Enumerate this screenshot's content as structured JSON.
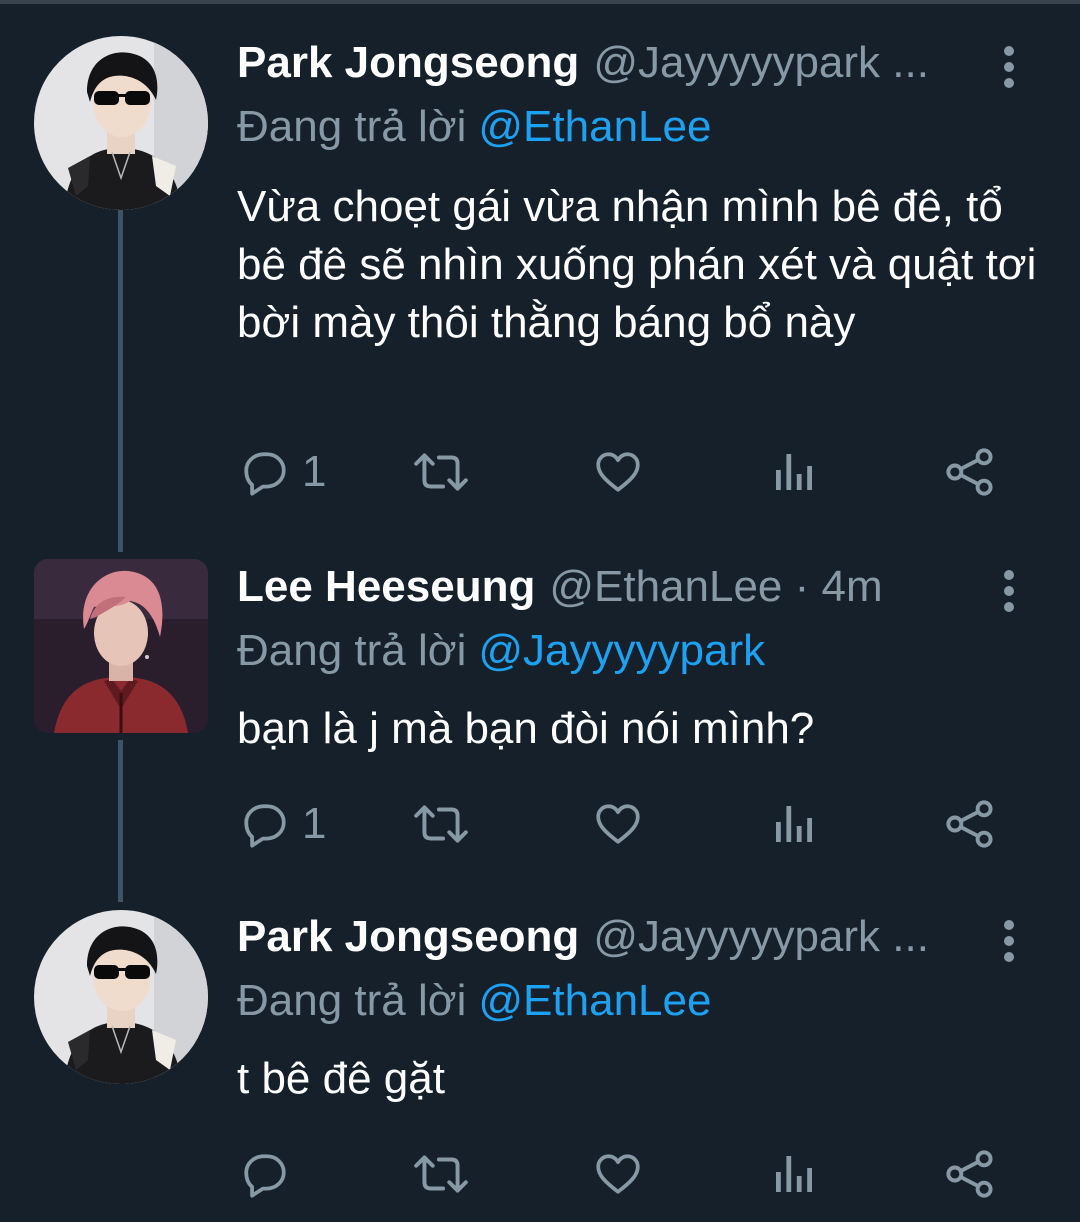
{
  "colors": {
    "background": "#15202b",
    "text": "#ffffff",
    "muted": "#8899a6",
    "link": "#1da1f2",
    "thread_line": "#3d5466"
  },
  "tweets": [
    {
      "display_name": "Park Jongseong",
      "handle": "@Jayyyyypark ...",
      "reply_prefix": "Đang trả lời",
      "reply_target": "@EthanLee",
      "text": "Vừa choẹt gái vừa nhận mình bê đê, tổ bê đê sẽ nhìn xuống phán xét và quật tơi bời mày thôi thằng báng bổ này",
      "reply_count": "1",
      "icons": [
        "reply-icon",
        "retweet-icon",
        "like-icon",
        "analytics-icon",
        "share-icon"
      ]
    },
    {
      "display_name": "Lee Heeseung",
      "handle": "@EthanLee · 4m",
      "reply_prefix": "Đang trả lời",
      "reply_target": "@Jayyyyypark",
      "text": "bạn là j mà bạn đòi nói mình?",
      "reply_count": "1",
      "icons": [
        "reply-icon",
        "retweet-icon",
        "like-icon",
        "analytics-icon",
        "share-icon"
      ]
    },
    {
      "display_name": "Park Jongseong",
      "handle": "@Jayyyyypark ...",
      "reply_prefix": "Đang trả lời",
      "reply_target": "@EthanLee",
      "text": "t bê đê gặt",
      "reply_count": "",
      "icons": [
        "reply-icon",
        "retweet-icon",
        "like-icon",
        "analytics-icon",
        "share-icon"
      ]
    }
  ]
}
